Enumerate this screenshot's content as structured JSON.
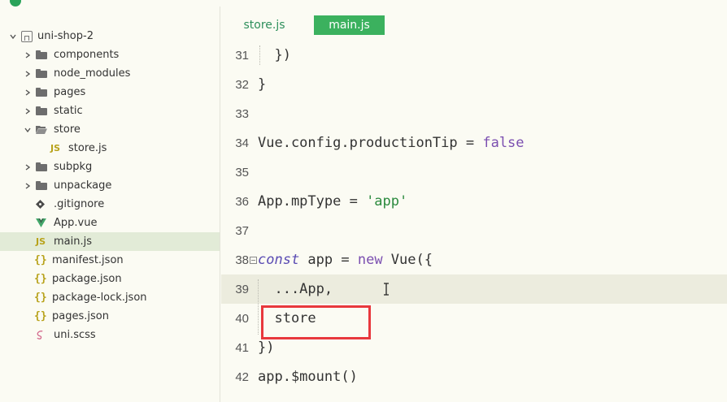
{
  "sidebar": {
    "root": {
      "label": "uni-shop-2"
    },
    "items": [
      {
        "label": "components",
        "kind": "folder"
      },
      {
        "label": "node_modules",
        "kind": "folder"
      },
      {
        "label": "pages",
        "kind": "folder"
      },
      {
        "label": "static",
        "kind": "folder"
      },
      {
        "label": "store",
        "kind": "folder-open"
      },
      {
        "label": "store.js",
        "kind": "js",
        "icon_text": "JS"
      },
      {
        "label": "subpkg",
        "kind": "folder"
      },
      {
        "label": "unpackage",
        "kind": "folder"
      },
      {
        "label": ".gitignore",
        "kind": "git"
      },
      {
        "label": "App.vue",
        "kind": "vue"
      },
      {
        "label": "main.js",
        "kind": "js",
        "icon_text": "JS",
        "selected": true
      },
      {
        "label": "manifest.json",
        "kind": "json",
        "icon_text": "{}"
      },
      {
        "label": "package.json",
        "kind": "json",
        "icon_text": "{}"
      },
      {
        "label": "package-lock.json",
        "kind": "json",
        "icon_text": "{}"
      },
      {
        "label": "pages.json",
        "kind": "json",
        "icon_text": "{}"
      },
      {
        "label": "uni.scss",
        "kind": "scss"
      }
    ]
  },
  "tabs": [
    {
      "label": "store.js",
      "active": false
    },
    {
      "label": "main.js",
      "active": true
    }
  ],
  "code": {
    "lines": [
      {
        "num": "31",
        "text": "  })"
      },
      {
        "num": "32",
        "text": "}"
      },
      {
        "num": "33",
        "text": ""
      },
      {
        "num": "34",
        "a": "Vue.config.productionTip = ",
        "b": "false"
      },
      {
        "num": "35",
        "text": ""
      },
      {
        "num": "36",
        "a": "App.mpType = ",
        "b": "'app'"
      },
      {
        "num": "37",
        "text": ""
      },
      {
        "num": "38",
        "a": "const",
        "b": " app = ",
        "c": "new",
        "d": " Vue({"
      },
      {
        "num": "39",
        "text": "  ...App,"
      },
      {
        "num": "40",
        "text": "  store"
      },
      {
        "num": "41",
        "text": "})"
      },
      {
        "num": "42",
        "text": "app.$mount()"
      }
    ]
  },
  "colors": {
    "accent_tab": "#3bb15e",
    "highlight_box": "#e8383d",
    "selected_row": "#e2ebd7"
  }
}
